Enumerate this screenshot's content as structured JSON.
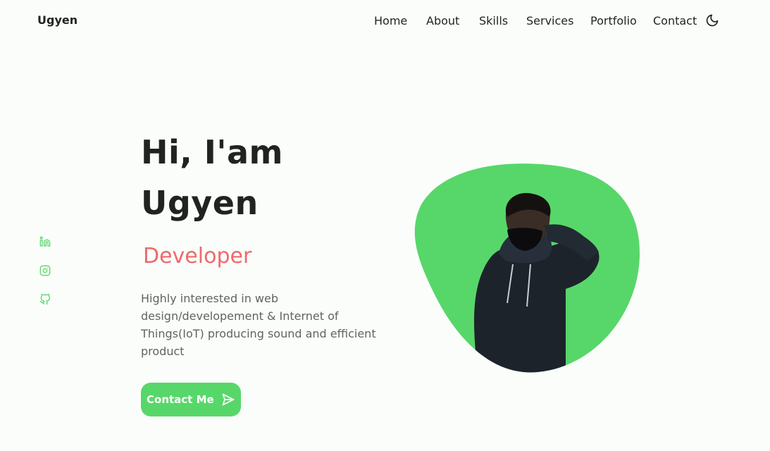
{
  "header": {
    "logo": "Ugyen",
    "nav": [
      {
        "label": "Home",
        "active": true
      },
      {
        "label": "About",
        "active": false
      },
      {
        "label": "Skills",
        "active": false
      },
      {
        "label": "Services",
        "active": false
      },
      {
        "label": "Portfolio",
        "active": false
      },
      {
        "label": "Contact",
        "active": false
      }
    ],
    "theme_toggle_icon": "moon-icon"
  },
  "socials": [
    {
      "icon": "linkedin-icon"
    },
    {
      "icon": "instagram-icon"
    },
    {
      "icon": "github-icon"
    }
  ],
  "hero": {
    "title_line1": "Hi, I'am",
    "title_line2": "Ugyen",
    "subtitle": "Developer",
    "description": "Highly interested in web design/developement & Internet of Things(IoT) producing sound and efficient product",
    "cta_label": "Contact Me",
    "cta_icon": "send-icon",
    "image_icon": "profile-photo"
  },
  "colors": {
    "accent": "#57d769",
    "subtitle": "#ef6a6a",
    "text": "#1f2421",
    "muted": "#5d6660",
    "background": "#fbfdfb"
  }
}
